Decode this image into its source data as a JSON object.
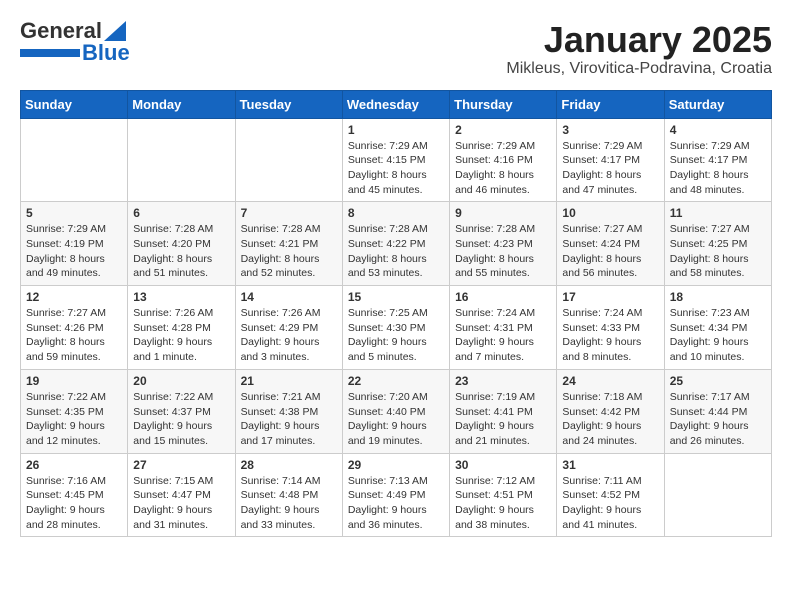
{
  "header": {
    "logo_general": "General",
    "logo_blue": "Blue",
    "title": "January 2025",
    "subtitle": "Mikleus, Virovitica-Podravina, Croatia"
  },
  "days_of_week": [
    "Sunday",
    "Monday",
    "Tuesday",
    "Wednesday",
    "Thursday",
    "Friday",
    "Saturday"
  ],
  "weeks": [
    [
      {
        "day": "",
        "info": ""
      },
      {
        "day": "",
        "info": ""
      },
      {
        "day": "",
        "info": ""
      },
      {
        "day": "1",
        "info": "Sunrise: 7:29 AM\nSunset: 4:15 PM\nDaylight: 8 hours and 45 minutes."
      },
      {
        "day": "2",
        "info": "Sunrise: 7:29 AM\nSunset: 4:16 PM\nDaylight: 8 hours and 46 minutes."
      },
      {
        "day": "3",
        "info": "Sunrise: 7:29 AM\nSunset: 4:17 PM\nDaylight: 8 hours and 47 minutes."
      },
      {
        "day": "4",
        "info": "Sunrise: 7:29 AM\nSunset: 4:17 PM\nDaylight: 8 hours and 48 minutes."
      }
    ],
    [
      {
        "day": "5",
        "info": "Sunrise: 7:29 AM\nSunset: 4:19 PM\nDaylight: 8 hours and 49 minutes."
      },
      {
        "day": "6",
        "info": "Sunrise: 7:28 AM\nSunset: 4:20 PM\nDaylight: 8 hours and 51 minutes."
      },
      {
        "day": "7",
        "info": "Sunrise: 7:28 AM\nSunset: 4:21 PM\nDaylight: 8 hours and 52 minutes."
      },
      {
        "day": "8",
        "info": "Sunrise: 7:28 AM\nSunset: 4:22 PM\nDaylight: 8 hours and 53 minutes."
      },
      {
        "day": "9",
        "info": "Sunrise: 7:28 AM\nSunset: 4:23 PM\nDaylight: 8 hours and 55 minutes."
      },
      {
        "day": "10",
        "info": "Sunrise: 7:27 AM\nSunset: 4:24 PM\nDaylight: 8 hours and 56 minutes."
      },
      {
        "day": "11",
        "info": "Sunrise: 7:27 AM\nSunset: 4:25 PM\nDaylight: 8 hours and 58 minutes."
      }
    ],
    [
      {
        "day": "12",
        "info": "Sunrise: 7:27 AM\nSunset: 4:26 PM\nDaylight: 8 hours and 59 minutes."
      },
      {
        "day": "13",
        "info": "Sunrise: 7:26 AM\nSunset: 4:28 PM\nDaylight: 9 hours and 1 minute."
      },
      {
        "day": "14",
        "info": "Sunrise: 7:26 AM\nSunset: 4:29 PM\nDaylight: 9 hours and 3 minutes."
      },
      {
        "day": "15",
        "info": "Sunrise: 7:25 AM\nSunset: 4:30 PM\nDaylight: 9 hours and 5 minutes."
      },
      {
        "day": "16",
        "info": "Sunrise: 7:24 AM\nSunset: 4:31 PM\nDaylight: 9 hours and 7 minutes."
      },
      {
        "day": "17",
        "info": "Sunrise: 7:24 AM\nSunset: 4:33 PM\nDaylight: 9 hours and 8 minutes."
      },
      {
        "day": "18",
        "info": "Sunrise: 7:23 AM\nSunset: 4:34 PM\nDaylight: 9 hours and 10 minutes."
      }
    ],
    [
      {
        "day": "19",
        "info": "Sunrise: 7:22 AM\nSunset: 4:35 PM\nDaylight: 9 hours and 12 minutes."
      },
      {
        "day": "20",
        "info": "Sunrise: 7:22 AM\nSunset: 4:37 PM\nDaylight: 9 hours and 15 minutes."
      },
      {
        "day": "21",
        "info": "Sunrise: 7:21 AM\nSunset: 4:38 PM\nDaylight: 9 hours and 17 minutes."
      },
      {
        "day": "22",
        "info": "Sunrise: 7:20 AM\nSunset: 4:40 PM\nDaylight: 9 hours and 19 minutes."
      },
      {
        "day": "23",
        "info": "Sunrise: 7:19 AM\nSunset: 4:41 PM\nDaylight: 9 hours and 21 minutes."
      },
      {
        "day": "24",
        "info": "Sunrise: 7:18 AM\nSunset: 4:42 PM\nDaylight: 9 hours and 24 minutes."
      },
      {
        "day": "25",
        "info": "Sunrise: 7:17 AM\nSunset: 4:44 PM\nDaylight: 9 hours and 26 minutes."
      }
    ],
    [
      {
        "day": "26",
        "info": "Sunrise: 7:16 AM\nSunset: 4:45 PM\nDaylight: 9 hours and 28 minutes."
      },
      {
        "day": "27",
        "info": "Sunrise: 7:15 AM\nSunset: 4:47 PM\nDaylight: 9 hours and 31 minutes."
      },
      {
        "day": "28",
        "info": "Sunrise: 7:14 AM\nSunset: 4:48 PM\nDaylight: 9 hours and 33 minutes."
      },
      {
        "day": "29",
        "info": "Sunrise: 7:13 AM\nSunset: 4:49 PM\nDaylight: 9 hours and 36 minutes."
      },
      {
        "day": "30",
        "info": "Sunrise: 7:12 AM\nSunset: 4:51 PM\nDaylight: 9 hours and 38 minutes."
      },
      {
        "day": "31",
        "info": "Sunrise: 7:11 AM\nSunset: 4:52 PM\nDaylight: 9 hours and 41 minutes."
      },
      {
        "day": "",
        "info": ""
      }
    ]
  ]
}
